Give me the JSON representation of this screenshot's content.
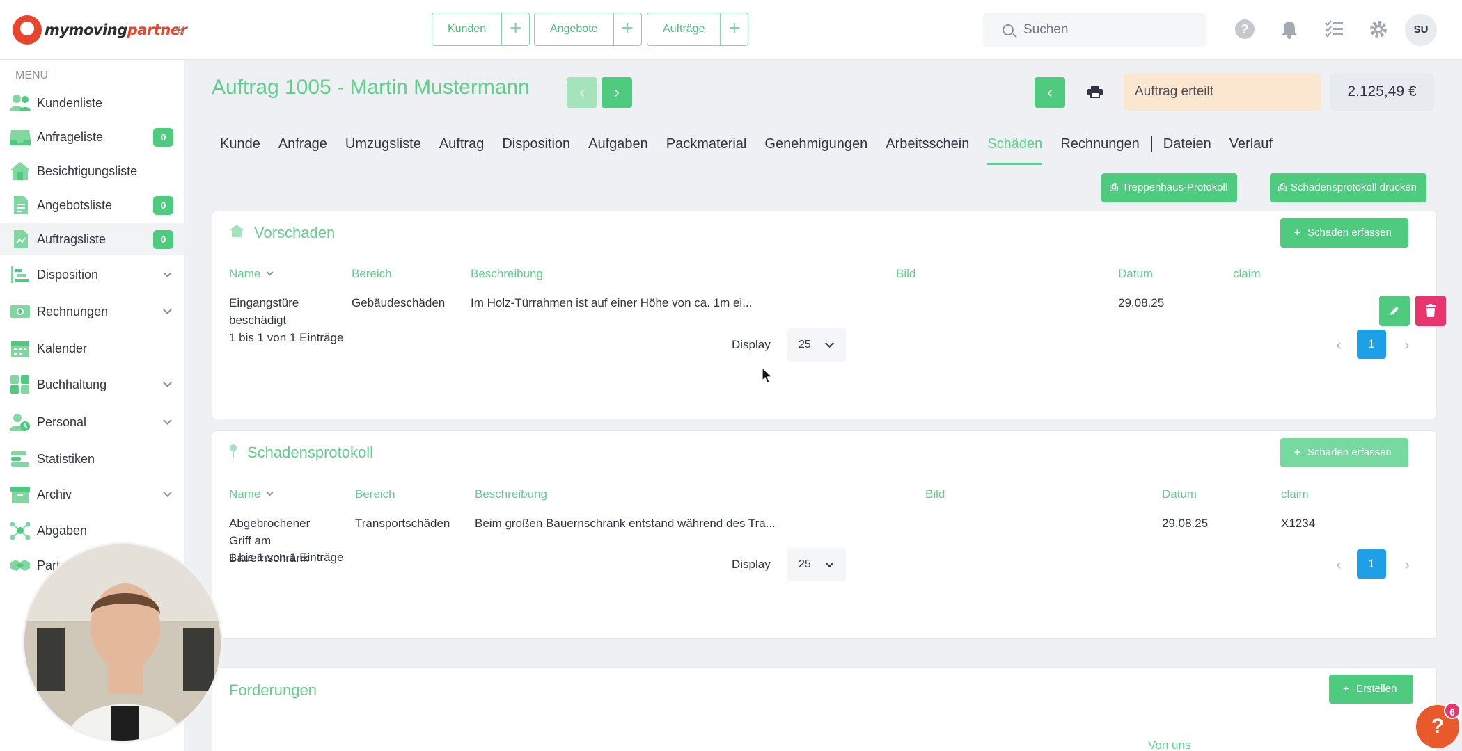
{
  "brand": {
    "name_main": "mymoving",
    "name_accent": "partner"
  },
  "quick_actions": [
    {
      "label": "Kunden"
    },
    {
      "label": "Angebote"
    },
    {
      "label": "Aufträge"
    }
  ],
  "search": {
    "placeholder": "Suchen"
  },
  "user": {
    "initials": "SU"
  },
  "sidebar": {
    "menu_label": "MENU",
    "items": [
      {
        "label": "Kundenliste",
        "icon": "customers-icon"
      },
      {
        "label": "Anfrageliste",
        "icon": "inbox-icon",
        "badge": "0"
      },
      {
        "label": "Besichtigungsliste",
        "icon": "house-icon"
      },
      {
        "label": "Angebotsliste",
        "icon": "offer-doc-icon",
        "badge": "0"
      },
      {
        "label": "Auftragsliste",
        "icon": "order-doc-icon",
        "badge": "0"
      },
      {
        "label": "Disposition",
        "icon": "gantt-icon"
      },
      {
        "label": "Rechnungen",
        "icon": "invoice-icon"
      },
      {
        "label": "Kalender",
        "icon": "calendar-icon"
      },
      {
        "label": "Buchhaltung",
        "icon": "accounting-icon"
      },
      {
        "label": "Personal",
        "icon": "staff-icon"
      },
      {
        "label": "Statistiken",
        "icon": "statistics-icon"
      },
      {
        "label": "Archiv",
        "icon": "archive-icon"
      },
      {
        "label": "Abgaben",
        "icon": "network-icon"
      },
      {
        "label": "Part",
        "icon": "handshake-icon"
      }
    ]
  },
  "order": {
    "title": "Auftrag 1005 - Martin Mustermann",
    "status": "Auftrag erteilt",
    "price": "2.125,49 €"
  },
  "tabs": [
    {
      "label": "Kunde"
    },
    {
      "label": "Anfrage"
    },
    {
      "label": "Umzugsliste"
    },
    {
      "label": "Auftrag"
    },
    {
      "label": "Disposition"
    },
    {
      "label": "Aufgaben"
    },
    {
      "label": "Packmaterial"
    },
    {
      "label": "Genehmigungen"
    },
    {
      "label": "Arbeitsschein"
    },
    {
      "label": "Schäden"
    },
    {
      "label": "Rechnungen"
    },
    {
      "label": "Dateien"
    },
    {
      "label": "Verlauf"
    }
  ],
  "actions": {
    "stair_protocol": "Treppenhaus-Protokoll",
    "damage_protocol_print": "Schadensprotokoll drucken"
  },
  "vorschaden": {
    "title": "Vorschaden",
    "add_label": "Schaden erfassen",
    "columns": {
      "name": "Name",
      "area": "Bereich",
      "description": "Beschreibung",
      "image": "Bild",
      "date": "Datum",
      "claim": "claim"
    },
    "rows": [
      {
        "name_1": "Eingangstüre",
        "name_2": "beschädigt",
        "area": "Gebäudeschäden",
        "description": "Im Holz-Türrahmen ist auf einer Höhe von ca. 1m ei...",
        "date": "29.08.25",
        "claim": ""
      }
    ],
    "info": "1 bis 1 von 1 Einträge",
    "display_label": "Display",
    "page_size": "25",
    "page": "1"
  },
  "schadensprotokoll": {
    "title": "Schadensprotokoll",
    "add_label": "Schaden erfassen",
    "columns": {
      "name": "Name",
      "area": "Bereich",
      "description": "Beschreibung",
      "image": "Bild",
      "date": "Datum",
      "claim": "claim"
    },
    "rows": [
      {
        "name_1": "Abgebrochener",
        "name_2": "Griff am",
        "name_3": "Bauernschrank",
        "area": "Transportschäden",
        "description": "Beim großen Bauernschrank entstand während des Tra...",
        "date": "29.08.25",
        "claim": "X1234"
      }
    ],
    "info": "1 bis 1 von 1 Einträge",
    "display_label": "Display",
    "page_size": "25",
    "page": "1"
  },
  "forderungen": {
    "title": "Forderungen",
    "create_label": "Erstellen",
    "column_from_us": "Von uns"
  },
  "help": {
    "badge": "6",
    "symbol": "?"
  },
  "colors": {
    "accent": "#5fd08c",
    "button": "#4ecb7e",
    "page_blue": "#1ea0e8",
    "danger": "#e8356d",
    "status_bg": "#fbe6cf"
  }
}
